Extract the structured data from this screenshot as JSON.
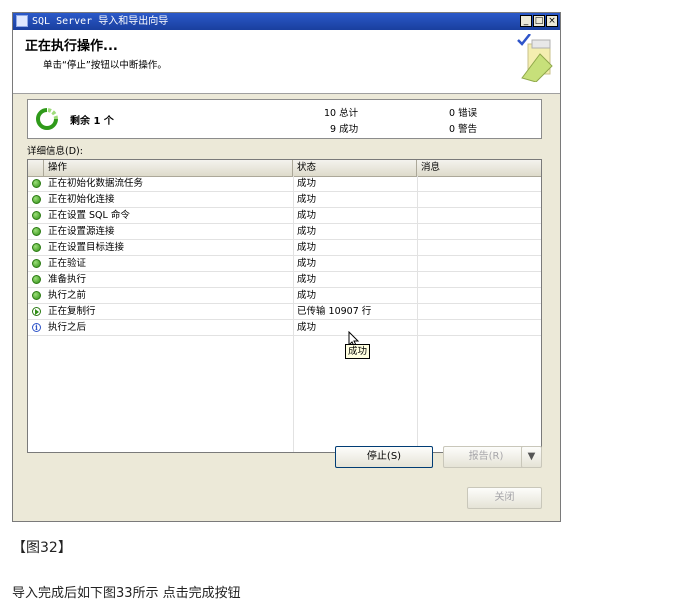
{
  "window": {
    "title": "SQL Server 导入和导出向导",
    "minimize_glyph": "_",
    "maximize_glyph": "□",
    "close_glyph": "×"
  },
  "header": {
    "title": "正在执行操作...",
    "subtitle": "单击“停止”按钮以中断操作。"
  },
  "summary": {
    "remaining": "剩余 1 个",
    "total": "10 总计",
    "success": "9 成功",
    "errors": "0 错误",
    "warnings": "0 警告"
  },
  "details": {
    "label": "详细信息(D):",
    "columns": [
      "操作",
      "状态",
      "消息"
    ],
    "rows": [
      {
        "icon": "ok",
        "action": "正在初始化数据流任务",
        "status": "成功",
        "message": ""
      },
      {
        "icon": "ok",
        "action": "正在初始化连接",
        "status": "成功",
        "message": ""
      },
      {
        "icon": "ok",
        "action": "正在设置 SQL 命令",
        "status": "成功",
        "message": ""
      },
      {
        "icon": "ok",
        "action": "正在设置源连接",
        "status": "成功",
        "message": ""
      },
      {
        "icon": "ok",
        "action": "正在设置目标连接",
        "status": "成功",
        "message": ""
      },
      {
        "icon": "ok",
        "action": "正在验证",
        "status": "成功",
        "message": ""
      },
      {
        "icon": "ok",
        "action": "准备执行",
        "status": "成功",
        "message": ""
      },
      {
        "icon": "ok",
        "action": "执行之前",
        "status": "成功",
        "message": ""
      },
      {
        "icon": "running",
        "action": "正在复制行",
        "status": "已传输 10907 行",
        "message": ""
      },
      {
        "icon": "info",
        "action": "执行之后",
        "status": "成功",
        "message": ""
      }
    ],
    "tooltip": "成功"
  },
  "buttons": {
    "stop": "停止(S)",
    "report": "报告(R)",
    "report_arrow": "▼",
    "close": "关闭"
  },
  "page": {
    "figure_caption": "【图32】",
    "instruction": "导入完成后如下图33所示 点击完成按钮"
  }
}
